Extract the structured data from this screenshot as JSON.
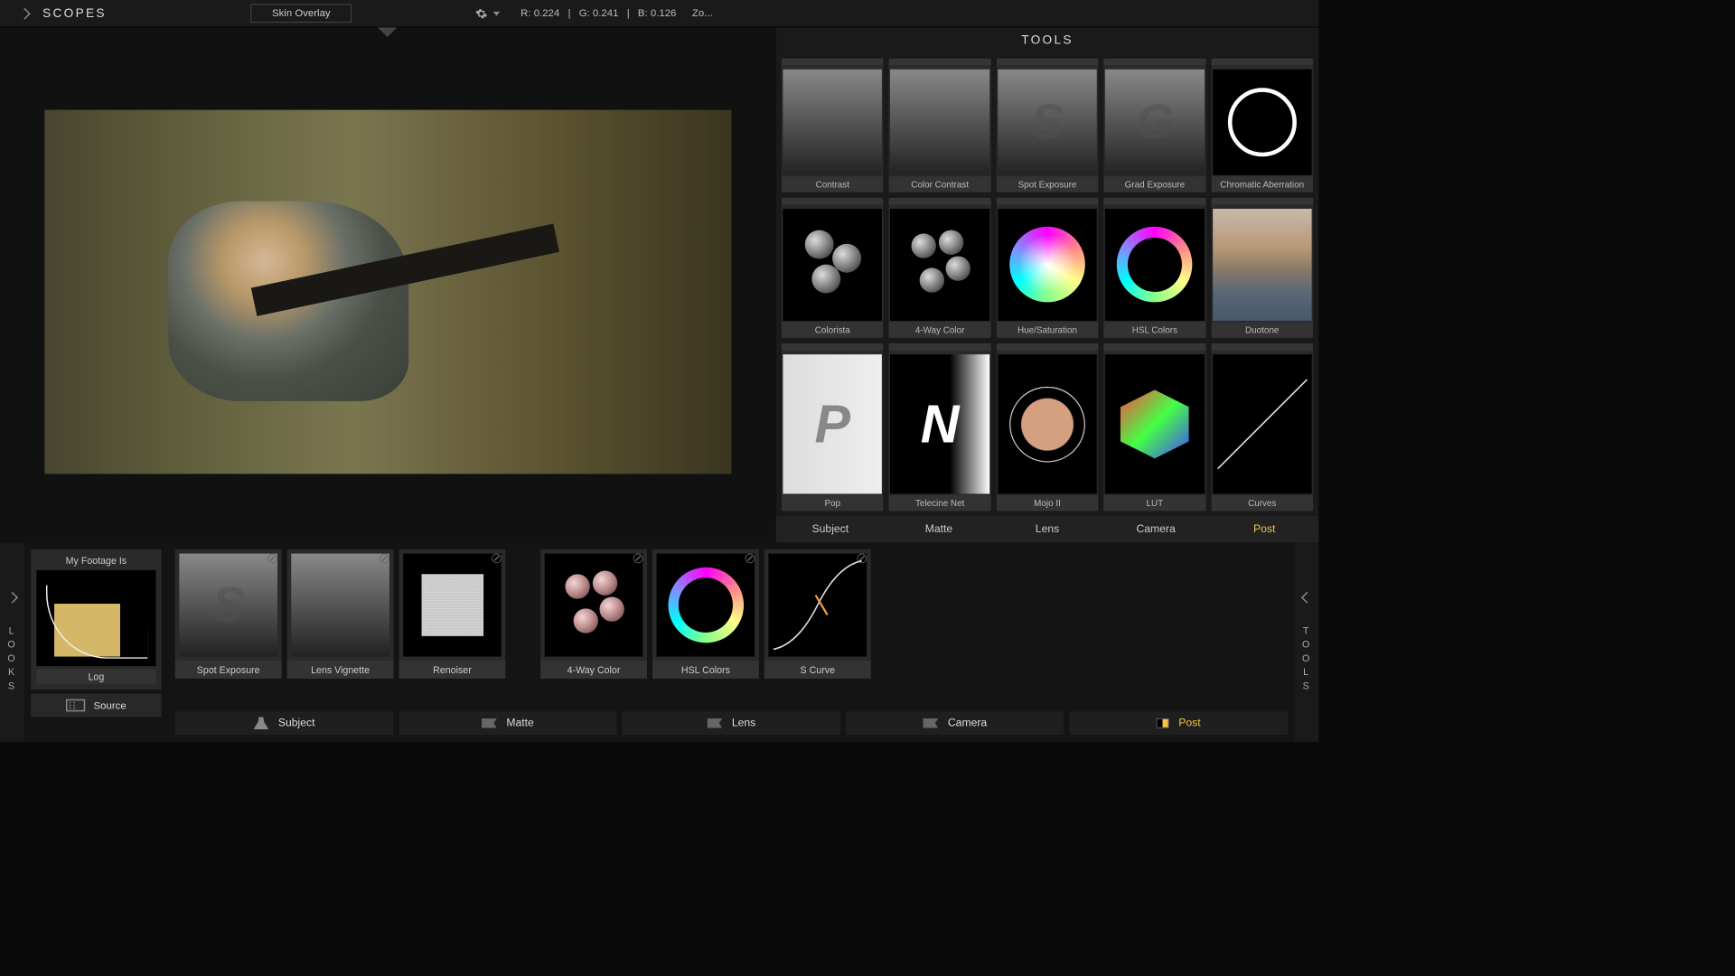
{
  "topbar": {
    "scopes_label": "SCOPES",
    "overlay_dropdown": "Skin Overlay",
    "rgb": {
      "r": "R: 0.224",
      "g": "G: 0.241",
      "b": "B: 0.126"
    },
    "zoom": "Zo..."
  },
  "tools_panel": {
    "title": "TOOLS",
    "items": [
      {
        "label": "Contrast",
        "thumb": "grad"
      },
      {
        "label": "Color Contrast",
        "thumb": "grad"
      },
      {
        "label": "Spot Exposure",
        "thumb": "grad-s",
        "letter": "S"
      },
      {
        "label": "Grad Exposure",
        "thumb": "grad-s",
        "letter": "G"
      },
      {
        "label": "Chromatic Aberration",
        "thumb": "ring"
      },
      {
        "label": "Colorista",
        "thumb": "balls3"
      },
      {
        "label": "4-Way Color",
        "thumb": "balls4"
      },
      {
        "label": "Hue/Saturation",
        "thumb": "huewheel-sat"
      },
      {
        "label": "HSL Colors",
        "thumb": "huewheel-ring"
      },
      {
        "label": "Duotone",
        "thumb": "duotone"
      },
      {
        "label": "Pop",
        "thumb": "pop",
        "letter": "P"
      },
      {
        "label": "Telecine Net",
        "thumb": "net",
        "letter": "N"
      },
      {
        "label": "Mojo II",
        "thumb": "mojo"
      },
      {
        "label": "LUT",
        "thumb": "lut"
      },
      {
        "label": "Curves",
        "thumb": "curve"
      }
    ],
    "categories": [
      "Subject",
      "Matte",
      "Lens",
      "Camera",
      "Post"
    ],
    "active_category": "Post"
  },
  "looks_rail": "LOOKS",
  "tools_rail": "TOOLS",
  "footage": {
    "title": "My Footage Is",
    "label": "Log",
    "source": "Source"
  },
  "chain": {
    "items": [
      {
        "label": "Spot Exposure",
        "thumb": "grad-s",
        "letter": "S"
      },
      {
        "label": "Lens Vignette",
        "thumb": "grad"
      },
      {
        "label": "Renoiser",
        "thumb": "noise"
      },
      {
        "label": "4-Way Color",
        "thumb": "balls4-pink"
      },
      {
        "label": "HSL Colors",
        "thumb": "huewheel-ring"
      },
      {
        "label": "S Curve",
        "thumb": "scurve"
      }
    ],
    "tabs": [
      {
        "label": "Subject",
        "icon": "person"
      },
      {
        "label": "Matte",
        "icon": "flag"
      },
      {
        "label": "Lens",
        "icon": "flag"
      },
      {
        "label": "Camera",
        "icon": "flag"
      },
      {
        "label": "Post",
        "icon": "half",
        "active": true
      }
    ]
  }
}
